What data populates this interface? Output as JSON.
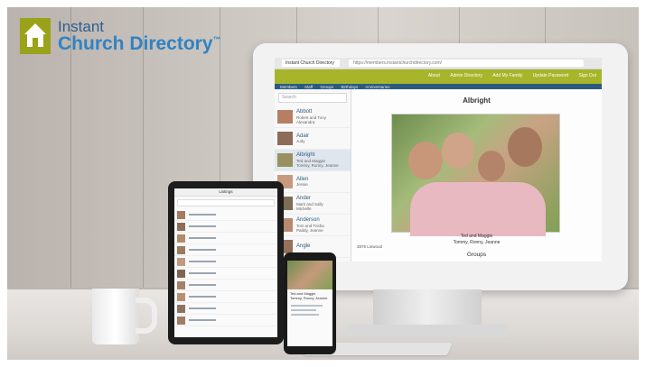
{
  "logo": {
    "line1": "Instant",
    "line2": "Church Directory",
    "trademark": "™",
    "brand_color": "#9aa21a",
    "text_color": "#2f83c2"
  },
  "monitor": {
    "browser": {
      "tab_label": "Instant Church Directory",
      "url": "https://members.instantchurchdirectory.com/"
    },
    "app": {
      "header_links": [
        "About",
        "Admin Directory",
        "Add My Family",
        "Update Password",
        "Sign Out"
      ],
      "nav_items": [
        "Members",
        "Staff",
        "Groups",
        "Birthdays",
        "Anniversaries"
      ],
      "header_color": "#a7b52a",
      "nav_color": "#2d5b7e",
      "search_placeholder": "Search",
      "list": [
        {
          "name": "Abbott",
          "sub": "Robert and Tony",
          "sub2": "Alexandra"
        },
        {
          "name": "Adair",
          "sub": "Judy",
          "sub2": ""
        },
        {
          "name": "Albright",
          "sub": "Ted and Maggie",
          "sub2": "Tommy, Ronny, Jeanne"
        },
        {
          "name": "Allen",
          "sub": "Jessie",
          "sub2": ""
        },
        {
          "name": "Ander",
          "sub": "Mark and Sally",
          "sub2": "Michelle"
        },
        {
          "name": "Anderson",
          "sub": "Tom and Trisha",
          "sub2": "Paddy, Jeanne"
        },
        {
          "name": "Angle",
          "sub": "",
          "sub2": ""
        }
      ],
      "selected_index": 2,
      "detail": {
        "family_name": "Albright",
        "caption_names": "Ted and Maggie",
        "caption_kids": "Tommy, Ronny, Jeanne",
        "address": "3875 Linwood",
        "section_title": "Groups"
      }
    }
  },
  "tablet": {
    "title": "Listings",
    "rows": 10
  },
  "phone": {
    "caption": "Ted and Maggie",
    "sub": "Tommy, Ronny, Jeanne"
  }
}
